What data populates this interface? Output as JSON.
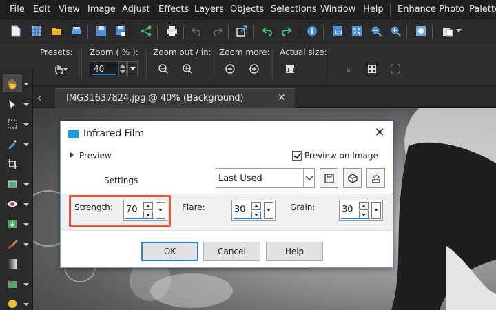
{
  "menubar": {
    "items": [
      "File",
      "Edit",
      "View",
      "Image",
      "Adjust",
      "Effects",
      "Layers",
      "Objects",
      "Selections",
      "Window",
      "Help",
      "Enhance Photo",
      "Palette"
    ]
  },
  "toolbar": {
    "icons": [
      "new-icon",
      "grid-icon",
      "open-folder-icon",
      "scanner-icon",
      "save-icon",
      "save-as-icon",
      "share-icon",
      "print-icon",
      "undo-icon",
      "redo-icon",
      "resize-icon",
      "revert-icon",
      "forward-icon",
      "info-icon",
      "zoom-100-icon",
      "fit-icon",
      "zoom-out-icon",
      "zoom-in-icon",
      "fit-window-icon",
      "paste-icon"
    ]
  },
  "options": {
    "presets_label": "Presets:",
    "zoom_label": "Zoom ( % ):",
    "zoom_value": "40",
    "zoom_out_in_label": "Zoom out / in:",
    "zoom_more_label": "Zoom more:",
    "actual_size_label": "Actual size:"
  },
  "tab": {
    "title": "IMG31637824.jpg @  40% (Background)",
    "close": "✕"
  },
  "dialog": {
    "title": "Infrared Film",
    "close": "✕",
    "preview_label": "Preview",
    "preview_on_image_label": "Preview on Image",
    "preview_on_image_checked": true,
    "settings_label": "Settings",
    "settings_value": "Last Used",
    "params": {
      "strength_label": "Strength:",
      "strength_value": "70",
      "flare_label": "Flare:",
      "flare_value": "30",
      "grain_label": "Grain:",
      "grain_value": "30"
    },
    "ok_label": "OK",
    "cancel_label": "Cancel",
    "help_label": "Help"
  },
  "colors": {
    "highlight": "#e05a3c",
    "accent": "#2f7fd6",
    "dialog_icon": "#1a9bd7"
  }
}
